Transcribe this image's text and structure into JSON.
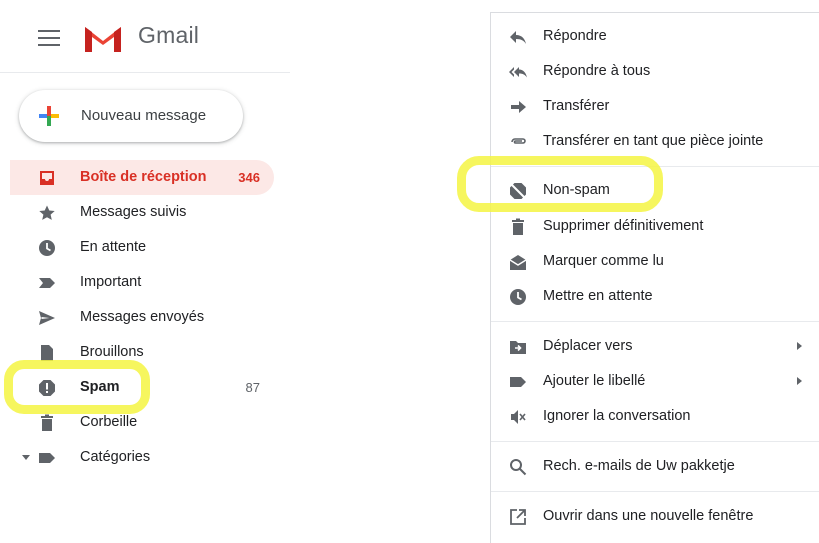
{
  "header": {
    "brand": "Gmail"
  },
  "compose": {
    "label": "Nouveau message"
  },
  "sidebar": {
    "items": [
      {
        "label": "Boîte de réception",
        "count": "346",
        "icon": "inbox-icon"
      },
      {
        "label": "Messages suivis",
        "count": "",
        "icon": "star-icon"
      },
      {
        "label": "En attente",
        "count": "",
        "icon": "clock-icon"
      },
      {
        "label": "Important",
        "count": "",
        "icon": "important-icon"
      },
      {
        "label": "Messages envoyés",
        "count": "",
        "icon": "send-icon"
      },
      {
        "label": "Brouillons",
        "count": "",
        "icon": "draft-icon"
      },
      {
        "label": "Spam",
        "count": "87",
        "icon": "spam-icon"
      },
      {
        "label": "Corbeille",
        "count": "",
        "icon": "trash-icon"
      },
      {
        "label": "Catégories",
        "count": "",
        "icon": "label-icon"
      }
    ]
  },
  "menu": {
    "items": [
      {
        "label": "Répondre",
        "icon": "reply-icon"
      },
      {
        "label": "Répondre à tous",
        "icon": "reply-all-icon"
      },
      {
        "label": "Transférer",
        "icon": "forward-icon"
      },
      {
        "label": "Transférer en tant que pièce jointe",
        "icon": "attachment-icon"
      },
      {
        "label": "Non-spam",
        "icon": "not-spam-icon"
      },
      {
        "label": "Supprimer définitivement",
        "icon": "trash-icon"
      },
      {
        "label": "Marquer comme lu",
        "icon": "mark-read-icon"
      },
      {
        "label": "Mettre en attente",
        "icon": "clock-icon"
      },
      {
        "label": "Déplacer vers",
        "icon": "move-to-icon"
      },
      {
        "label": "Ajouter le libellé",
        "icon": "label-icon"
      },
      {
        "label": "Ignorer la conversation",
        "icon": "mute-icon"
      },
      {
        "label": "Rech. e-mails de Uw pakketje",
        "icon": "search-icon"
      },
      {
        "label": "Ouvrir dans une nouvelle fenêtre",
        "icon": "open-new-window-icon"
      }
    ]
  },
  "colors": {
    "accent": "#d93025",
    "active_bg": "#fce8e6",
    "highlight": "#f5f542",
    "icon": "#5f6368"
  }
}
